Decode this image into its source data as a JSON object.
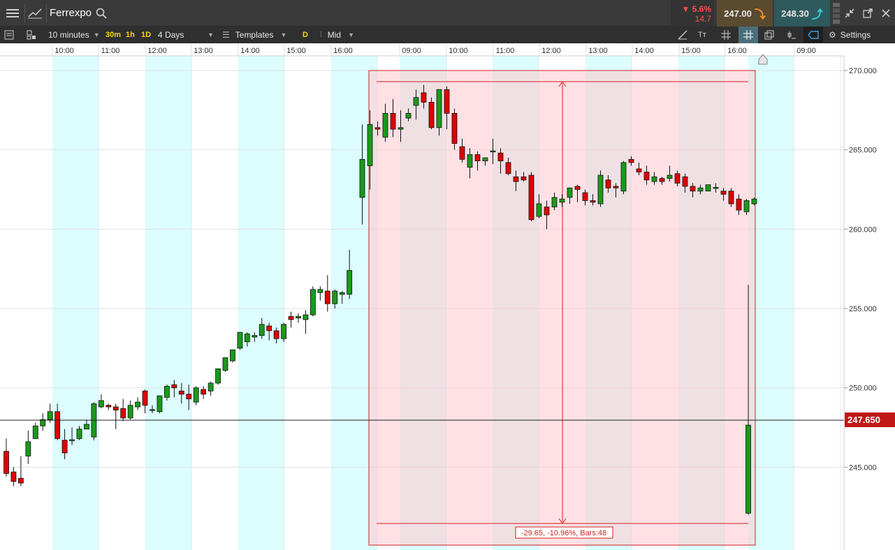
{
  "header": {
    "instrument": "Ferrexpo",
    "change_pct": "▼ 5.6%",
    "change_abs": "14.7",
    "sell_price": "247.00",
    "buy_price": "248.30"
  },
  "toolbar": {
    "interval": "10 minutes",
    "quick_30m": "30m",
    "quick_1h": "1h",
    "quick_1d": "1D",
    "range": "4 Days",
    "templates": "Templates",
    "d_button": "D",
    "price_mode": "Mid",
    "settings": "Settings"
  },
  "colors": {
    "up": "#1a9a1a",
    "down": "#e00000",
    "band": "#dcfcfd",
    "measure_fill": "#ffe1e3",
    "measure_stroke": "#d02020",
    "last_price_bg": "#c01818"
  },
  "chart_data": {
    "type": "candlestick",
    "current_price": "247.650",
    "measurement_label": "-29.65, -10.96%, Bars:48",
    "y_ticks": [
      "270.000",
      "265.000",
      "260.000",
      "255.000",
      "250.000",
      "245.000"
    ],
    "x_ticks": [
      "10:00",
      "11:00",
      "12:00",
      "13:00",
      "14:00",
      "15:00",
      "16:00",
      "09:00",
      "10:00",
      "11:00",
      "12:00",
      "13:00",
      "14:00",
      "15:00",
      "16:00",
      "09:00"
    ],
    "candles": [
      [
        246.0,
        246.8,
        244.6,
        244.4
      ],
      [
        244.7,
        245.0,
        244.1,
        243.8
      ],
      [
        244.3,
        245.7,
        244.0,
        243.8
      ],
      [
        245.7,
        247.3,
        246.6,
        245.2
      ],
      [
        246.8,
        247.8,
        247.6,
        246.8
      ],
      [
        247.6,
        248.4,
        248.0,
        247.3
      ],
      [
        248.0,
        249.0,
        248.5,
        247.8
      ],
      [
        248.5,
        249.0,
        246.8,
        246.7
      ],
      [
        246.7,
        247.4,
        245.9,
        245.5
      ],
      [
        246.7,
        247.5,
        246.7,
        246.4
      ],
      [
        246.8,
        247.6,
        247.4,
        246.7
      ],
      [
        247.4,
        248.0,
        247.7,
        247.4
      ],
      [
        246.9,
        249.1,
        249.0,
        246.7
      ],
      [
        248.8,
        249.6,
        249.2,
        248.7
      ],
      [
        248.9,
        249.0,
        248.8,
        248.6
      ],
      [
        248.8,
        249.0,
        248.6,
        247.4
      ],
      [
        248.7,
        249.3,
        248.1,
        247.9
      ],
      [
        248.1,
        249.2,
        248.9,
        248.0
      ],
      [
        248.8,
        249.4,
        249.1,
        248.6
      ],
      [
        249.8,
        249.9,
        248.9,
        248.4
      ],
      [
        248.6,
        248.9,
        248.6,
        248.4
      ],
      [
        248.5,
        249.4,
        249.5,
        248.4
      ],
      [
        249.4,
        250.2,
        250.1,
        249.2
      ],
      [
        250.2,
        250.5,
        250.0,
        249.4
      ],
      [
        249.8,
        250.3,
        249.6,
        249.0
      ],
      [
        249.6,
        250.2,
        249.3,
        248.6
      ],
      [
        249.1,
        250.1,
        250.0,
        248.9
      ],
      [
        249.9,
        250.1,
        249.6,
        249.3
      ],
      [
        249.8,
        250.4,
        250.3,
        249.5
      ],
      [
        250.3,
        251.2,
        251.2,
        250.2
      ],
      [
        251.1,
        251.8,
        251.9,
        251.0
      ],
      [
        251.7,
        252.4,
        252.4,
        251.6
      ],
      [
        252.5,
        253.5,
        253.5,
        252.4
      ],
      [
        252.9,
        253.5,
        253.4,
        252.6
      ],
      [
        253.2,
        253.5,
        253.3,
        252.9
      ],
      [
        253.3,
        254.4,
        254.0,
        253.1
      ],
      [
        253.9,
        254.1,
        253.6,
        253.0
      ],
      [
        253.6,
        253.8,
        253.1,
        252.8
      ],
      [
        253.1,
        254.1,
        254.0,
        252.9
      ],
      [
        254.5,
        254.8,
        254.3,
        253.8
      ],
      [
        254.4,
        254.7,
        254.5,
        254.1
      ],
      [
        254.3,
        254.9,
        254.6,
        253.4
      ],
      [
        254.6,
        256.4,
        256.2,
        254.5
      ],
      [
        256.0,
        256.4,
        256.2,
        255.5
      ],
      [
        256.1,
        257.1,
        255.3,
        254.8
      ],
      [
        255.3,
        256.2,
        256.1,
        255.0
      ],
      [
        255.9,
        256.1,
        256.0,
        255.3
      ],
      [
        255.9,
        258.7,
        257.4,
        255.6
      ],
      [
        262.0,
        266.6,
        264.4,
        260.3
      ],
      [
        264.0,
        267.5,
        266.6,
        262.5
      ],
      [
        266.4,
        266.8,
        266.3,
        265.9
      ],
      [
        265.8,
        267.9,
        267.3,
        265.5
      ],
      [
        267.3,
        268.2,
        266.3,
        265.8
      ],
      [
        266.3,
        267.5,
        266.4,
        265.5
      ],
      [
        267.0,
        267.6,
        267.3,
        266.8
      ],
      [
        267.8,
        268.8,
        268.3,
        266.9
      ],
      [
        268.6,
        269.1,
        268.0,
        267.6
      ],
      [
        268.0,
        268.3,
        266.4,
        266.3
      ],
      [
        266.4,
        268.3,
        268.8,
        265.9
      ],
      [
        268.8,
        269.0,
        267.3,
        266.3
      ],
      [
        267.3,
        267.6,
        265.4,
        265.0
      ],
      [
        265.2,
        265.7,
        264.4,
        264.2
      ],
      [
        263.9,
        265.1,
        264.7,
        263.2
      ],
      [
        264.7,
        264.9,
        264.3,
        263.7
      ],
      [
        264.3,
        264.5,
        264.5,
        264.0
      ],
      [
        264.9,
        265.7,
        264.9,
        264.1
      ],
      [
        264.8,
        265.1,
        264.3,
        263.5
      ],
      [
        264.2,
        264.5,
        263.5,
        263.4
      ],
      [
        263.3,
        263.7,
        263.0,
        262.4
      ],
      [
        263.3,
        263.6,
        263.1,
        263.0
      ],
      [
        263.4,
        263.6,
        260.6,
        260.5
      ],
      [
        260.8,
        262.2,
        261.6,
        260.7
      ],
      [
        261.4,
        261.8,
        260.9,
        260.0
      ],
      [
        261.4,
        262.3,
        262.0,
        261.2
      ],
      [
        261.7,
        262.2,
        261.9,
        261.4
      ],
      [
        262.0,
        262.6,
        262.6,
        261.6
      ],
      [
        262.7,
        262.8,
        262.5,
        261.7
      ],
      [
        262.3,
        262.5,
        261.8,
        261.5
      ],
      [
        261.8,
        262.2,
        261.7,
        261.5
      ],
      [
        261.6,
        263.7,
        263.4,
        261.4
      ],
      [
        263.1,
        263.4,
        262.6,
        262.3
      ],
      [
        262.7,
        262.9,
        262.6,
        262.0
      ],
      [
        262.4,
        264.3,
        264.2,
        262.2
      ],
      [
        264.4,
        264.6,
        264.2,
        264.0
      ],
      [
        263.8,
        264.2,
        263.6,
        263.4
      ],
      [
        263.6,
        264.0,
        263.1,
        262.8
      ],
      [
        263.0,
        263.6,
        263.3,
        262.8
      ],
      [
        263.2,
        263.3,
        263.0,
        262.8
      ],
      [
        263.2,
        264.0,
        263.4,
        263.0
      ],
      [
        263.5,
        263.7,
        262.9,
        262.7
      ],
      [
        263.3,
        263.5,
        262.7,
        262.3
      ],
      [
        262.7,
        262.9,
        262.4,
        262.0
      ],
      [
        262.4,
        262.8,
        262.6,
        262.2
      ],
      [
        262.4,
        262.8,
        262.8,
        262.4
      ],
      [
        262.6,
        262.9,
        262.6,
        262.3
      ],
      [
        262.4,
        262.6,
        262.2,
        261.8
      ],
      [
        262.4,
        262.6,
        261.6,
        261.4
      ],
      [
        261.9,
        262.2,
        261.2,
        260.9
      ],
      [
        261.1,
        261.9,
        261.8,
        260.9
      ],
      [
        261.6,
        262.0,
        261.9,
        261.5
      ],
      [
        242.1,
        256.5,
        247.65,
        242.0
      ]
    ]
  }
}
